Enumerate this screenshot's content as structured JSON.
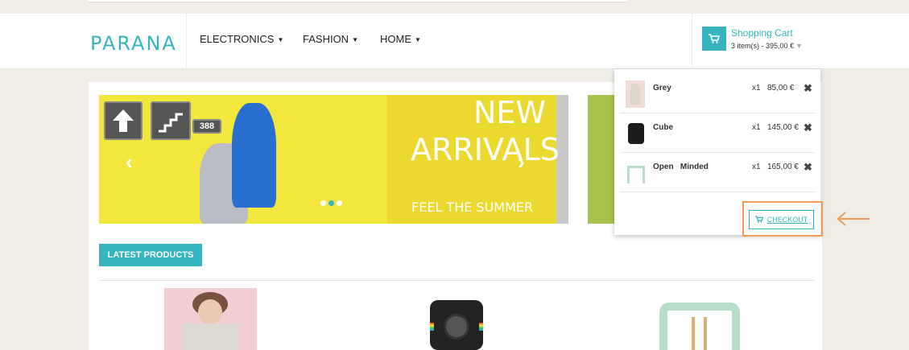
{
  "header": {
    "logo": "PARANA",
    "nav": [
      {
        "label": "ELECTRONICS"
      },
      {
        "label": "FASHION"
      },
      {
        "label": "HOME"
      }
    ],
    "cart": {
      "title": "Shopping Cart",
      "summary": "3 item(s) - 395,00 €"
    }
  },
  "banner": {
    "sign_number": "388",
    "headline_1": "NEW",
    "headline_2": "ARRIVALS",
    "tagline": "FEEL THE SUMMER",
    "prev_icon": "‹",
    "next_icon": "›"
  },
  "section": {
    "latest_label": "LATEST PRODUCTS"
  },
  "cart_dropdown": {
    "items": [
      {
        "name": "Grey",
        "qty": "x1",
        "price": "85,00 €",
        "remove": "✖"
      },
      {
        "name": "Cube",
        "qty": "x1",
        "price": "145,00 €",
        "remove": "✖"
      },
      {
        "name": "Open   Minded",
        "qty": "x1",
        "price": "165,00 €",
        "remove": "✖"
      }
    ],
    "checkout_label": "CHECKOUT"
  },
  "colors": {
    "accent": "#36b5c0",
    "highlight": "#f29a5a",
    "banner_yellow": "#f3e63d",
    "green": "#a7c34d"
  },
  "icons": {
    "cart": "cart-icon",
    "remove": "close-icon",
    "arrow": "arrow-left-icon"
  }
}
